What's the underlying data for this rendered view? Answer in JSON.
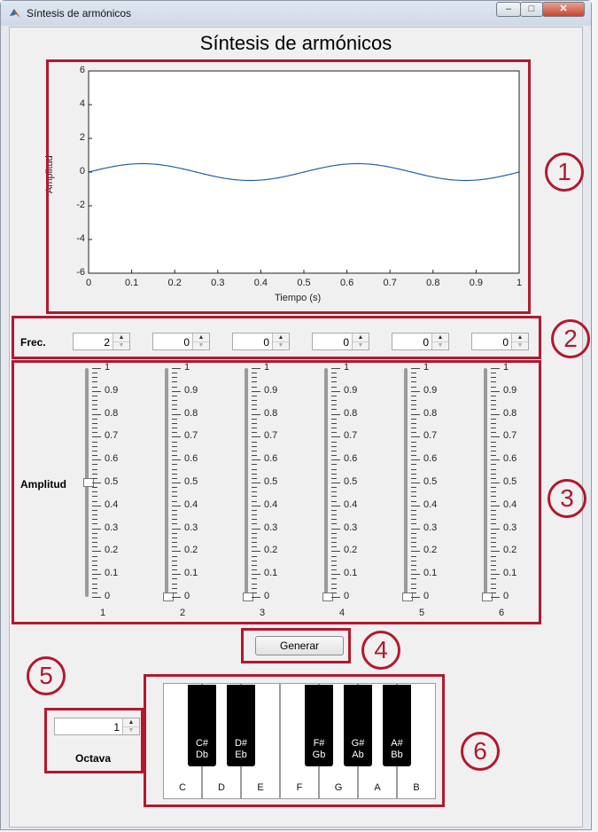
{
  "window": {
    "title": "Síntesis de armónicos",
    "btn_min": "–",
    "btn_max": "□",
    "btn_close": "✕"
  },
  "main_title": "Síntesis de armónicos",
  "chart_data": {
    "type": "line",
    "xlabel": "Tiempo (s)",
    "ylabel": "Amplitud",
    "xlim": [
      0,
      1
    ],
    "ylim": [
      -6,
      6
    ],
    "x_ticks": [
      "0",
      "0.1",
      "0.2",
      "0.3",
      "0.4",
      "0.5",
      "0.6",
      "0.7",
      "0.8",
      "0.9",
      "1"
    ],
    "y_ticks": [
      "6",
      "4",
      "2",
      "0",
      "-2",
      "-4",
      "-6"
    ],
    "series": [
      {
        "frequency": 2,
        "amplitude": 0.5,
        "x": [
          0,
          0.05,
          0.1,
          0.125,
          0.15,
          0.2,
          0.25,
          0.3,
          0.35,
          0.375,
          0.4,
          0.45,
          0.5,
          0.55,
          0.6,
          0.625,
          0.65,
          0.7,
          0.75,
          0.8,
          0.85,
          0.875,
          0.9,
          0.95,
          1
        ],
        "y": [
          0,
          0.29,
          0.48,
          0.5,
          0.48,
          0.29,
          0,
          -0.29,
          -0.48,
          -0.5,
          -0.48,
          -0.29,
          0,
          0.29,
          0.48,
          0.5,
          0.48,
          0.29,
          0,
          -0.29,
          -0.48,
          -0.5,
          -0.48,
          -0.29,
          0
        ]
      }
    ],
    "line_color": "#1f5fa8",
    "grid": false
  },
  "freq": {
    "label": "Frec.",
    "values": [
      "2",
      "0",
      "0",
      "0",
      "0",
      "0"
    ]
  },
  "amp": {
    "label": "Amplitud",
    "scale": [
      "1",
      "0.9",
      "0.8",
      "0.7",
      "0.6",
      "0.5",
      "0.4",
      "0.3",
      "0.2",
      "0.1",
      "0"
    ],
    "slider_values": [
      0.5,
      0,
      0,
      0,
      0,
      0
    ],
    "slider_numbers": [
      "1",
      "2",
      "3",
      "4",
      "5",
      "6"
    ]
  },
  "generate_label": "Generar",
  "octave": {
    "value": "1",
    "label": "Octava"
  },
  "keyboard": {
    "white": [
      "C",
      "D",
      "E",
      "F",
      "G",
      "A",
      "B"
    ],
    "black": [
      {
        "sharp": "C#",
        "flat": "Db"
      },
      {
        "sharp": "D#",
        "flat": "Eb"
      },
      {
        "sharp": "F#",
        "flat": "Gb"
      },
      {
        "sharp": "G#",
        "flat": "Ab"
      },
      {
        "sharp": "A#",
        "flat": "Bb"
      }
    ]
  },
  "annotations": [
    "1",
    "2",
    "3",
    "4",
    "5",
    "6"
  ],
  "colors": {
    "annotation_red": "#b3182e",
    "plot_line": "#1f5fa8"
  }
}
